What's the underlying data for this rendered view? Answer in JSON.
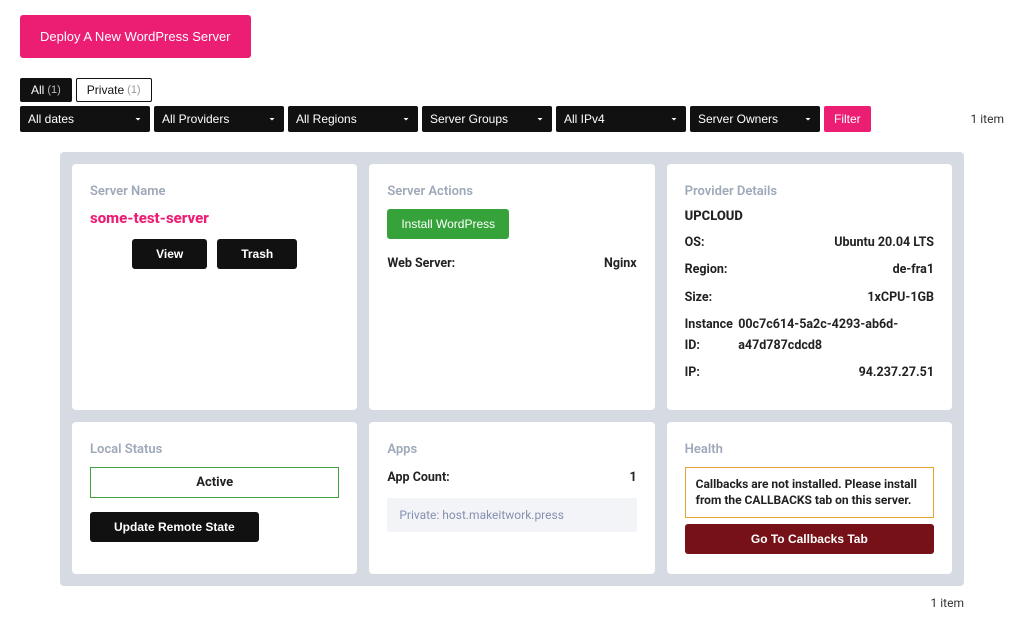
{
  "deploy_label": "Deploy A New WordPress Server",
  "tabs": [
    {
      "label": "All",
      "count": "(1)"
    },
    {
      "label": "Private",
      "count": "(1)"
    }
  ],
  "filters": {
    "dates": "All dates",
    "providers": "All Providers",
    "regions": "All Regions",
    "groups": "Server Groups",
    "ipv4": "All IPv4",
    "owners": "Server Owners",
    "button": "Filter"
  },
  "items_text": "1 item",
  "server": {
    "name_label": "Server Name",
    "name": "some-test-server",
    "view": "View",
    "trash": "Trash",
    "actions_label": "Server Actions",
    "install_wp": "Install WordPress",
    "webserver_label": "Web Server:",
    "webserver": "Nginx",
    "provider_label": "Provider Details",
    "provider": "UPCLOUD",
    "os_label": "OS:",
    "os": "Ubuntu 20.04 LTS",
    "region_label": "Region:",
    "region": "de-fra1",
    "size_label": "Size:",
    "size": "1xCPU-1GB",
    "instance_label": "Instance ID:",
    "instance": "00c7c614-5a2c-4293-ab6d-a47d787cdcd8",
    "ip_label": "IP:",
    "ip": "94.237.27.51"
  },
  "local": {
    "title": "Local Status",
    "status": "Active",
    "update": "Update Remote State"
  },
  "apps": {
    "title": "Apps",
    "count_label": "App Count:",
    "count": "1",
    "entry": "Private: host.makeitwork.press"
  },
  "health": {
    "title": "Health",
    "warn": "Callbacks are not installed. Please install from the CALLBACKS tab on this server.",
    "button": "Go To Callbacks Tab"
  }
}
